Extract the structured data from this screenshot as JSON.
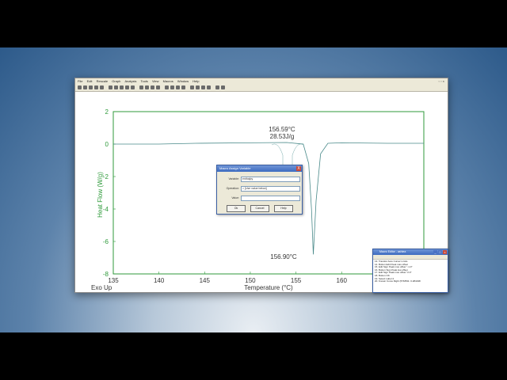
{
  "menu": [
    "File",
    "Edit",
    "Rescale",
    "Graph",
    "Analysis",
    "Tools",
    "View",
    "Macros",
    "Window",
    "Help"
  ],
  "colors": {
    "axis_green": "#2f9a3b",
    "curve": "#4a8a8a",
    "annotation": "#333333"
  },
  "chart_data": {
    "type": "line",
    "xlabel": "Temperature (°C)",
    "ylabel": "Heat Flow (W/g)",
    "corner_label": "Exo Up",
    "xlim": [
      135,
      169
    ],
    "ylim": [
      -8,
      2
    ],
    "xticks": [
      "135",
      "140",
      "145",
      "150",
      "155",
      "160",
      "165"
    ],
    "yticks": [
      "2",
      "0",
      "-2",
      "-4",
      "-6",
      "-8"
    ],
    "series": [
      {
        "x": [
          135,
          140,
          144,
          150,
          154,
          155.8,
          156.4,
          156.7,
          156.9,
          157.2,
          157.7,
          158.5,
          160,
          165,
          169
        ],
        "y": [
          0.0,
          0.0,
          0.05,
          0.08,
          0.1,
          0.0,
          -1.2,
          -4.0,
          -6.8,
          -3.5,
          -0.6,
          0.05,
          0.08,
          0.05,
          0.05
        ]
      }
    ],
    "annotations": {
      "onset_temp": "156.59°C",
      "enthalpy": "28.53J/g",
      "peak_temp": "156.90°C"
    }
  },
  "dialog": {
    "title": "Macro Assign Variable",
    "close": "X",
    "variable_label": "Variable:",
    "variable_value": "enthalpy",
    "operation_label": "Operation:",
    "operation_value": "= [Use value below]",
    "value_label": "Value:",
    "value_value": "",
    "ok": "Ok",
    "cancel": "Cancel",
    "help": "Help"
  },
  "macro_editor": {
    "title": "Macro Editor - ashiea",
    "lines": [
      "13. Transfer Auto Cursor Limits",
      "14. Button Edit Peak max offset",
      "15. Edit Sign Peak max offset \"-1.0\"",
      "16. Button Sign Peak low offset",
      "17. Edit Sign Peak max offset \"2.0\"",
      "18. Button OK",
      "19. Select Label 4",
      "20. Known Curve Right (576/591: 0.284198"
    ]
  }
}
